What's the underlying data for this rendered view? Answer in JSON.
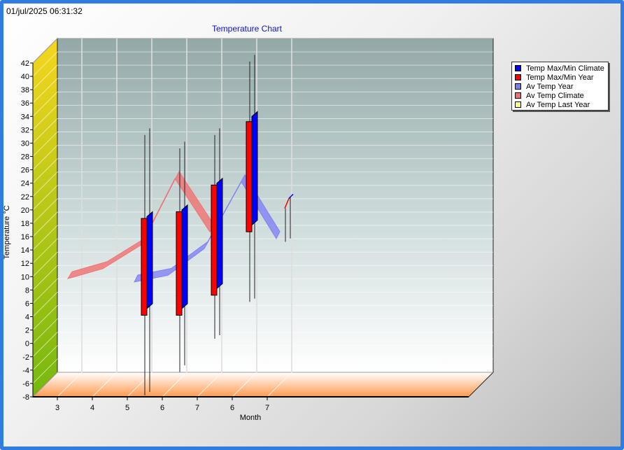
{
  "timestamp": "01/jul/2025 06:31:32",
  "chart_data": {
    "type": "candlestick-3d",
    "title": "Temperature Chart",
    "xlabel": "Month",
    "ylabel": "Temperature °C",
    "ylim": [
      -8,
      42
    ],
    "yticks": [
      -8,
      -6,
      -4,
      -2,
      0,
      2,
      4,
      6,
      8,
      10,
      12,
      14,
      16,
      18,
      20,
      22,
      24,
      26,
      28,
      30,
      32,
      34,
      36,
      38,
      40,
      42
    ],
    "xticks": [
      "3",
      "4",
      "5",
      "6",
      "7",
      "6",
      "7"
    ],
    "grid": true,
    "legend_position": "right",
    "legend": [
      {
        "name": "Temp Max/Min Climate",
        "color": "#0000ff"
      },
      {
        "name": "Temp Max/Min Year",
        "color": "#ff0000"
      },
      {
        "name": "Av Temp Year",
        "color": "#7b7bf5"
      },
      {
        "name": "Av Temp Climate",
        "color": "#f07070"
      },
      {
        "name": "Av Temp Last Year",
        "color": "#ffff80"
      }
    ],
    "series": [
      {
        "name": "Temp Max/Min Climate",
        "boxes": [
          {
            "x": 5,
            "low": 7,
            "high": 21.5,
            "min": -5.5,
            "max": 34
          },
          {
            "x": 6,
            "low": 7,
            "high": 22.5,
            "min": -1.5,
            "max": 32
          },
          {
            "x": 7,
            "low": 10,
            "high": 26.5,
            "min": 3,
            "max": 34
          },
          {
            "x": 6,
            "low": 19.5,
            "high": 36.5,
            "min": 8.5,
            "max": 45
          }
        ]
      },
      {
        "name": "Temp Max/Min Year",
        "boxes": [
          {
            "x": 5,
            "low": 6,
            "high": 20.5,
            "min": -6,
            "max": 33
          },
          {
            "x": 6,
            "low": 6,
            "high": 21.5,
            "min": -2.5,
            "max": 31
          },
          {
            "x": 7,
            "low": 9,
            "high": 25.5,
            "min": 2.5,
            "max": 33
          },
          {
            "x": 6,
            "low": 18.5,
            "high": 35,
            "min": 8,
            "max": 44
          }
        ]
      },
      {
        "name": "Av Temp Year",
        "points": [
          {
            "x": 5,
            "y": 11.5
          },
          {
            "x": 6,
            "y": 12.5
          },
          {
            "x": 7,
            "y": 16.5
          },
          {
            "x": 6,
            "y": 26.5
          },
          {
            "x": 7,
            "y": 18
          }
        ]
      },
      {
        "name": "Av Temp Climate",
        "points": [
          {
            "x": 3,
            "y": 12
          },
          {
            "x": 4,
            "y": 13.5
          },
          {
            "x": 5,
            "y": 17
          },
          {
            "x": 6,
            "y": 27
          },
          {
            "x": 7,
            "y": 19
          }
        ]
      },
      {
        "name": "Av Temp Last Year",
        "points": [
          {
            "x": 7,
            "y": 22
          },
          {
            "x": 7,
            "y": 23.5
          }
        ]
      }
    ]
  }
}
